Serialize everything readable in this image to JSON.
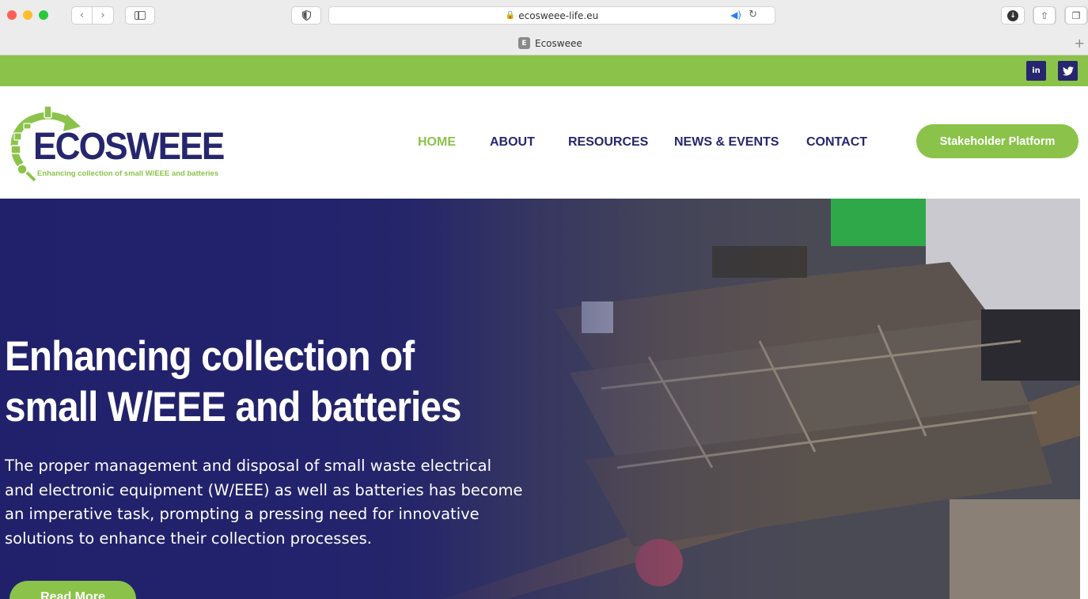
{
  "browser": {
    "url": "ecosweee-life.eu",
    "tab_title": "Ecosweee",
    "tab_favicon": "E"
  },
  "topbar": {
    "social": [
      {
        "name": "linkedin-icon",
        "glyph": "in"
      },
      {
        "name": "twitter-icon",
        "glyph": "✈"
      }
    ]
  },
  "header": {
    "logo_word": "ECOSWEEE",
    "logo_tagline": "Enhancing collection of small W/EEE and batteries",
    "nav": [
      {
        "label": "HOME",
        "active": true
      },
      {
        "label": "ABOUT",
        "active": false
      },
      {
        "label": "RESOURCES",
        "active": false
      },
      {
        "label": "NEWS & EVENTS",
        "active": false
      },
      {
        "label": "CONTACT",
        "active": false
      }
    ],
    "cta_label": "Stakeholder Platform"
  },
  "hero": {
    "title_line1": "Enhancing collection of",
    "title_line2": "small W/EEE and batteries",
    "body_lines": [
      "The proper management and disposal of small waste electrical",
      "and electronic equipment (W/EEE) as well as batteries has become",
      "an imperative task, prompting a pressing need for innovative",
      "solutions to enhance their collection processes."
    ],
    "button_label": "Read More"
  },
  "colors": {
    "brand_navy": "#26266f",
    "brand_green": "#8bc34a"
  }
}
